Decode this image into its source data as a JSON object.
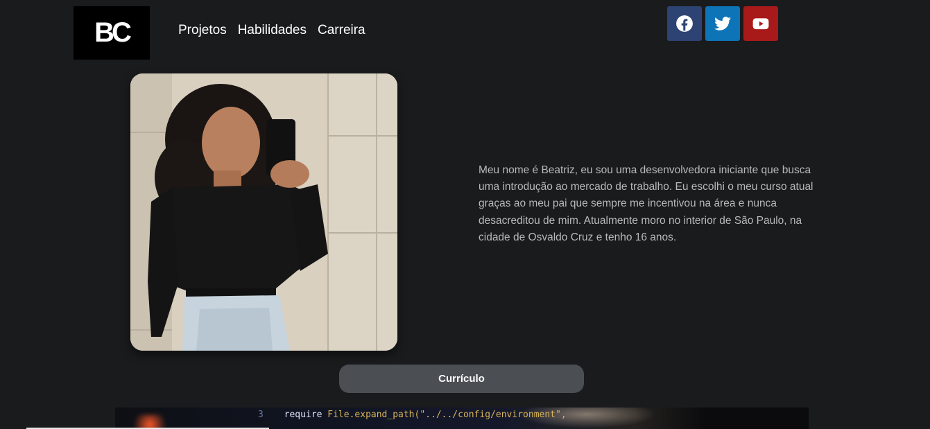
{
  "header": {
    "logo_text": "BC",
    "nav": [
      {
        "label": "Projetos"
      },
      {
        "label": "Habilidades"
      },
      {
        "label": "Carreira"
      }
    ],
    "social": [
      {
        "name": "facebook-icon",
        "color": "#2d4373"
      },
      {
        "name": "twitter-icon",
        "color": "#0d74b8"
      },
      {
        "name": "youtube-icon",
        "color": "#a81a1a"
      }
    ]
  },
  "about": {
    "bio": "Meu nome é Beatriz, eu sou uma desenvolvedora iniciante que busca uma introdução ao mercado de trabalho. Eu escolhi o meu curso atual graças ao meu pai que sempre me incentivou na área e nunca desacreditou de mim. Atualmente moro no interior de São Paulo, na cidade de Osvaldo Cruz e tenho 16 anos."
  },
  "cv_button": {
    "label": "Currículo"
  },
  "banner": {
    "line_number": "3",
    "code_keyword": "require",
    "code_text": "File.expand_path(\"../../config/environment\","
  }
}
